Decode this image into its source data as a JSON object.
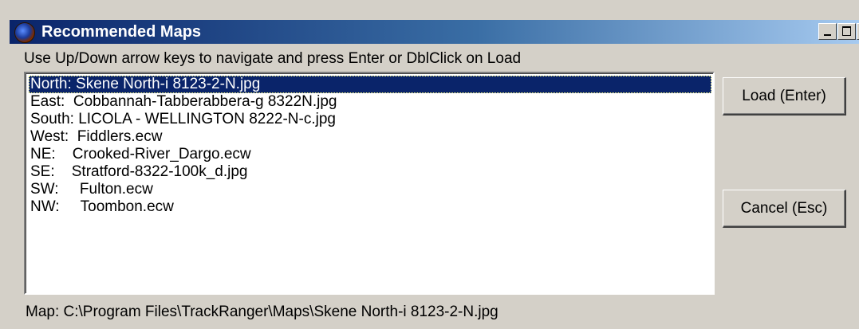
{
  "window": {
    "title": "Recommended Maps",
    "close_glyph": "X"
  },
  "instruction": "Use Up/Down arrow keys to navigate and press Enter or DblClick on Load",
  "list": {
    "items": [
      {
        "label": "North: Skene North-i 8123-2-N.jpg",
        "selected": true
      },
      {
        "label": "East:  Cobbannah-Tabberabbera-g 8322N.jpg",
        "selected": false
      },
      {
        "label": "South: LICOLA - WELLINGTON 8222-N-c.jpg",
        "selected": false
      },
      {
        "label": "West:  Fiddlers.ecw",
        "selected": false
      },
      {
        "label": "NE:    Crooked-River_Dargo.ecw",
        "selected": false
      },
      {
        "label": "SE:    Stratford-8322-100k_d.jpg",
        "selected": false
      },
      {
        "label": "SW:     Fulton.ecw",
        "selected": false
      },
      {
        "label": "NW:     Toombon.ecw",
        "selected": false
      }
    ]
  },
  "buttons": {
    "load_label": "Load (Enter)",
    "cancel_label": "Cancel (Esc)"
  },
  "status": "Map: C:\\Program Files\\TrackRanger\\Maps\\Skene North-i 8123-2-N.jpg",
  "colors": {
    "titlebar_start": "#0a246a",
    "titlebar_end": "#a6caf0",
    "selection": "#0a246a",
    "face": "#d4d0c8"
  }
}
